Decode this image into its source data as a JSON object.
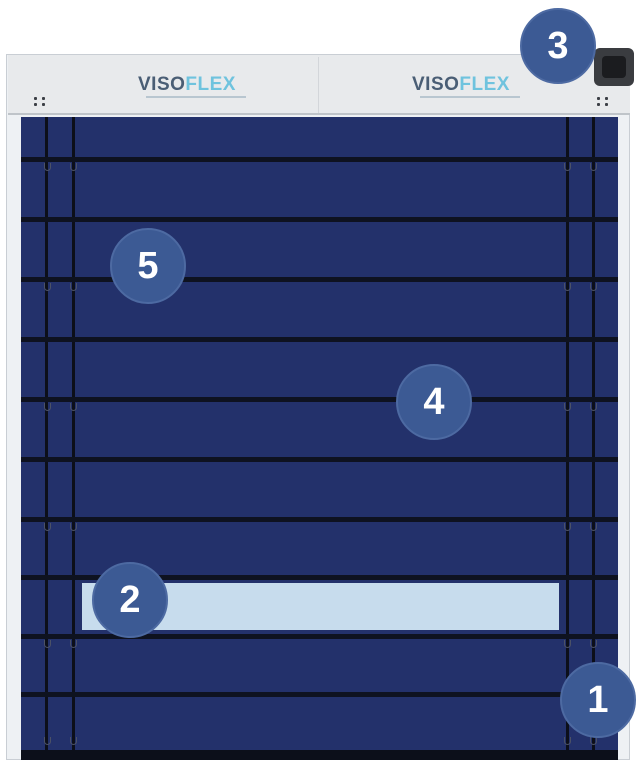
{
  "header": {
    "logo_left": {
      "viso": "VISO",
      "flex": "FLEX"
    },
    "logo_right": {
      "viso": "VISO",
      "flex": "FLEX"
    }
  },
  "markers": [
    {
      "id": "marker-1",
      "label": "1"
    },
    {
      "id": "marker-2",
      "label": "2"
    },
    {
      "id": "marker-3",
      "label": "3"
    },
    {
      "id": "marker-4",
      "label": "4"
    },
    {
      "id": "marker-5",
      "label": "5"
    }
  ],
  "colors": {
    "curtain": "#23316b",
    "window": "#c7dced",
    "marker": "#3c5a94",
    "frame": "#eef1f4"
  }
}
